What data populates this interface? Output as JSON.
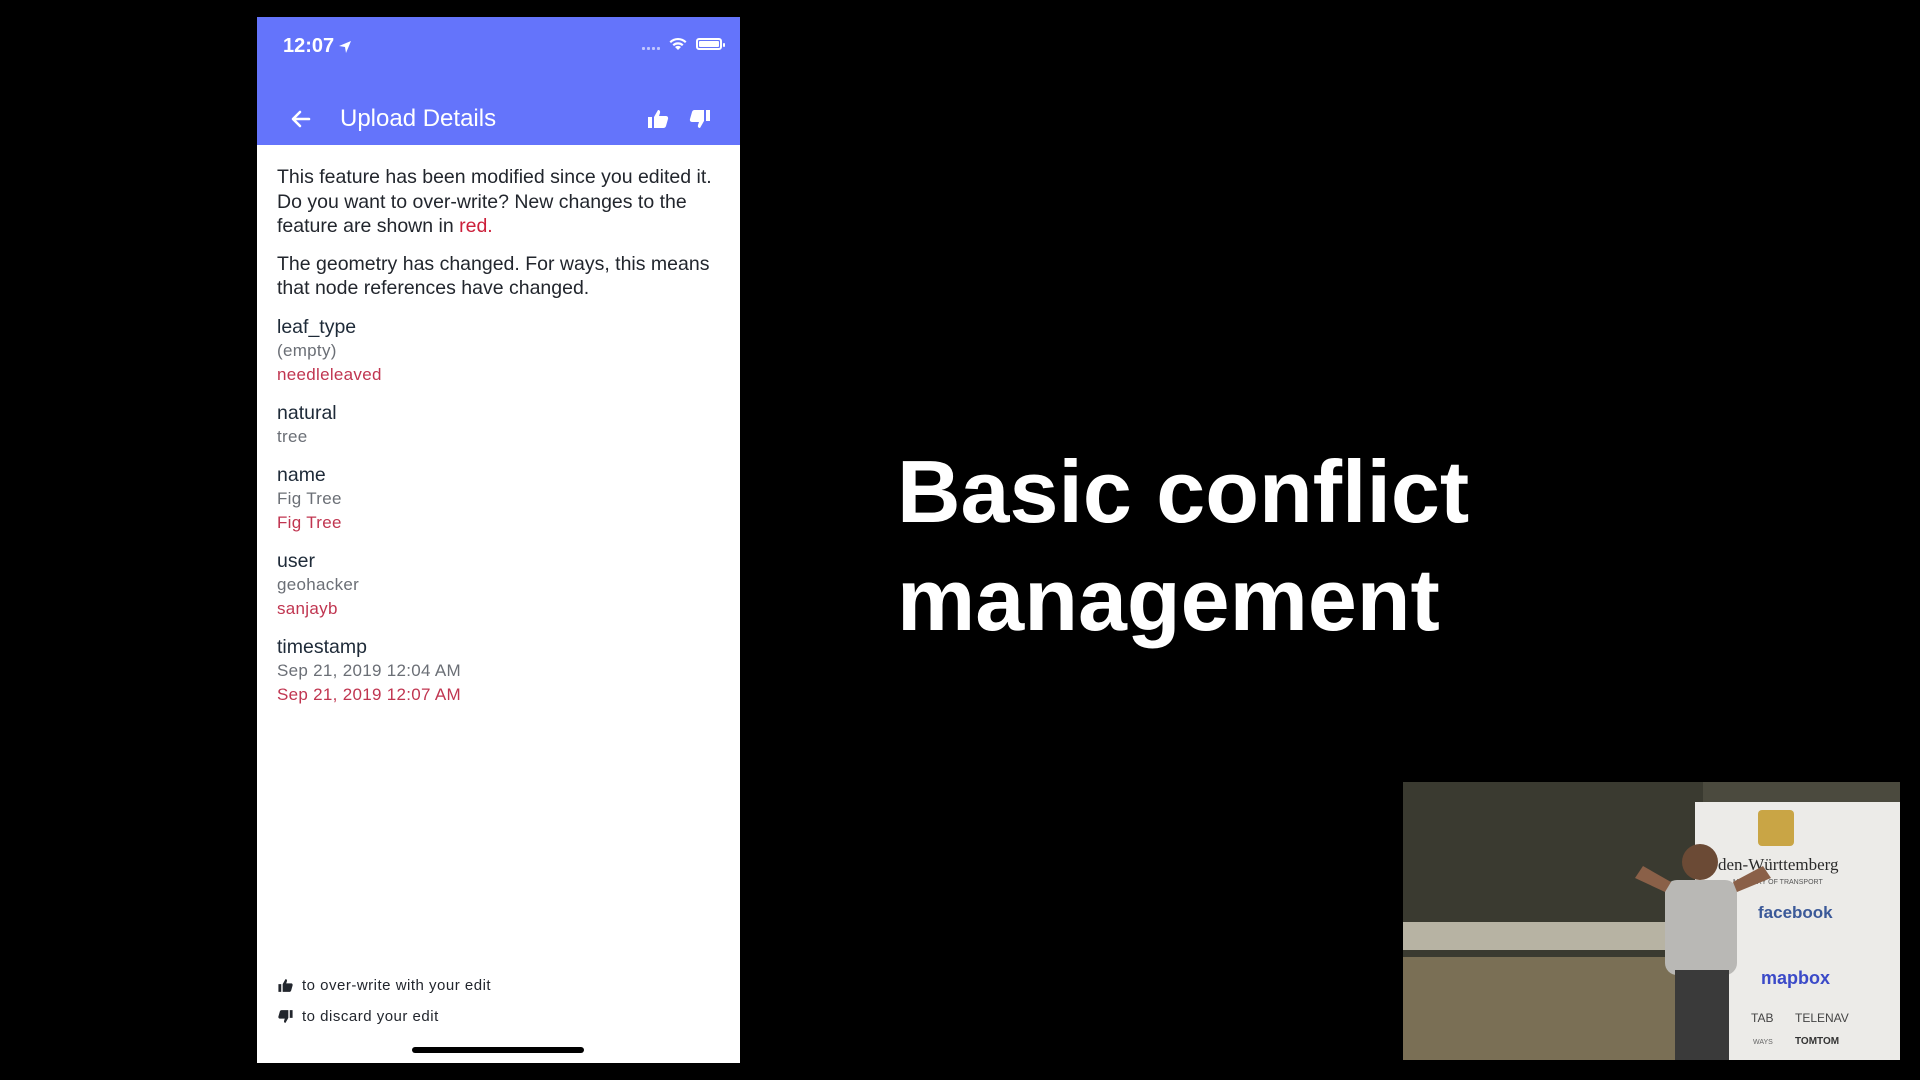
{
  "status_bar": {
    "time": "12:07",
    "battery_level": 0.9
  },
  "app_bar": {
    "title": "Upload Details",
    "background": "#6474fb"
  },
  "message": {
    "line1": "This feature has been modified since you edited it.",
    "line2_prefix": "Do you want to over-write? New changes to the feature are shown in ",
    "line2_red": "red.",
    "geometry_note": "The geometry has changed. For ways, this means that node references have changed."
  },
  "fields": [
    {
      "key": "leaf_type",
      "old": "(empty)",
      "new": "needleleaved"
    },
    {
      "key": "natural",
      "old": "tree",
      "new": null
    },
    {
      "key": "name",
      "old": "Fig Tree",
      "new": "Fig Tree"
    },
    {
      "key": "user",
      "old": "geohacker",
      "new": "sanjayb"
    },
    {
      "key": "timestamp",
      "old": "Sep 21, 2019 12:04 AM",
      "new": "Sep 21, 2019 12:07 AM"
    }
  ],
  "legend": {
    "overwrite": "to over-write with your edit",
    "discard": "to discard your edit"
  },
  "slide": {
    "title_line1": "Basic conflict",
    "title_line2": "management"
  },
  "video": {
    "banner_text": "den-Württemberg",
    "banner_sub": "MINISTRY OF TRANSPORT",
    "sponsor_facebook": "facebook",
    "sponsor_mapbox": "mapbox",
    "sponsor_telenav": "TELENAV",
    "sponsor_tomtom": "TOMTOM",
    "sponsor_grab": "TAB",
    "sponsor_ways": "WAYS"
  }
}
